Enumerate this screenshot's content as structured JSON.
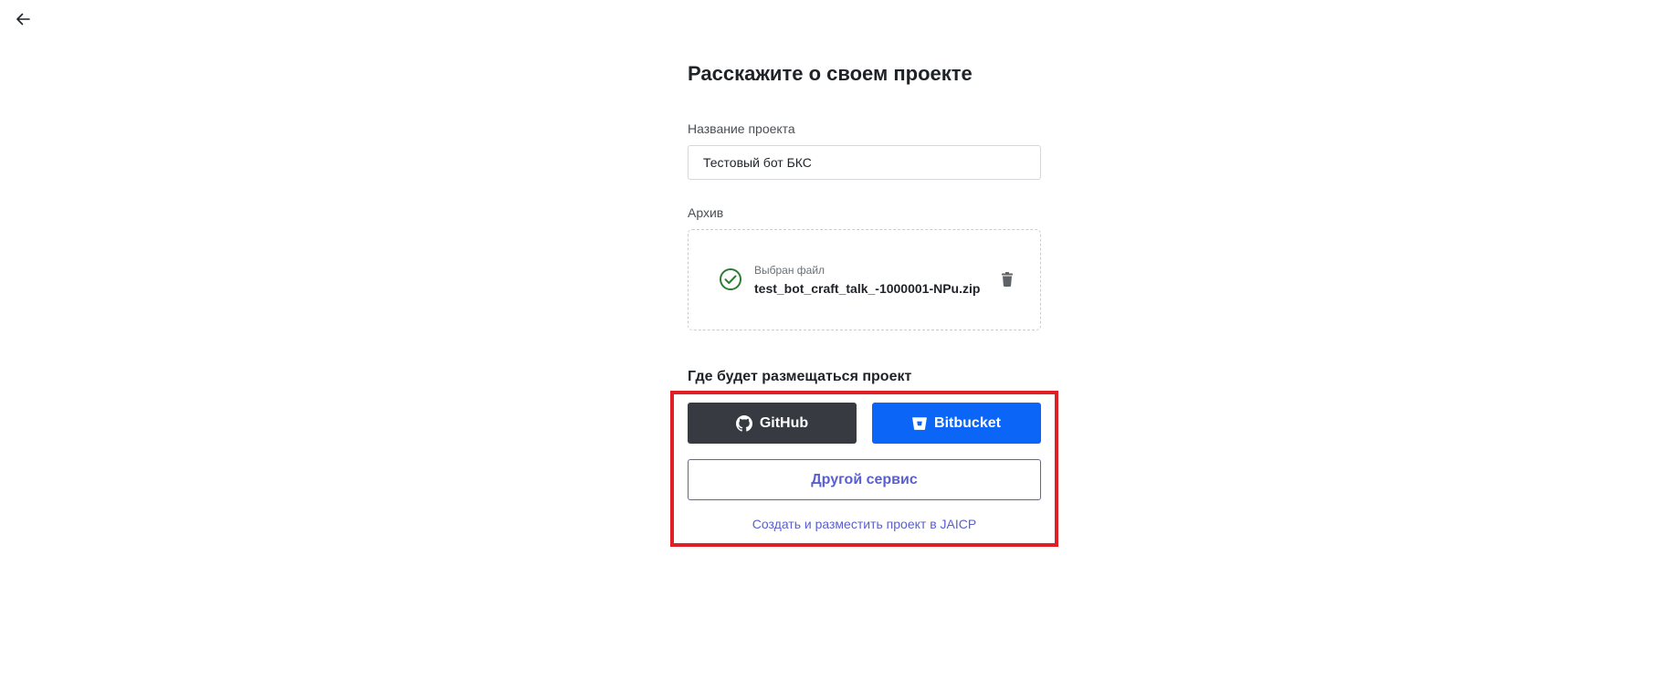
{
  "nav": {
    "back_icon": "arrow-left-icon"
  },
  "form": {
    "title": "Расскажите о своем проекте",
    "name_label": "Название проекта",
    "name_value": "Тестовый бот БКС",
    "archive_label": "Архив",
    "archive": {
      "status_icon": "check-circle-icon",
      "status_color": "#2e7d32",
      "caption": "Выбран файл",
      "file_name": "test_bot_craft_talk_-1000001-NPu.zip",
      "delete_icon": "trash-icon"
    }
  },
  "hosting": {
    "title": "Где будет размещаться проект",
    "github_label": "GitHub",
    "github_icon": "github-icon",
    "github_color": "#373b41",
    "bitbucket_label": "Bitbucket",
    "bitbucket_icon": "bitbucket-icon",
    "bitbucket_color": "#0b66f8",
    "other_label": "Другой сервис",
    "other_color": "#5a5fd0",
    "jaicp_link": "Создать и разместить проект в JAICP"
  },
  "annotation": {
    "highlight_color": "#e01e26"
  }
}
